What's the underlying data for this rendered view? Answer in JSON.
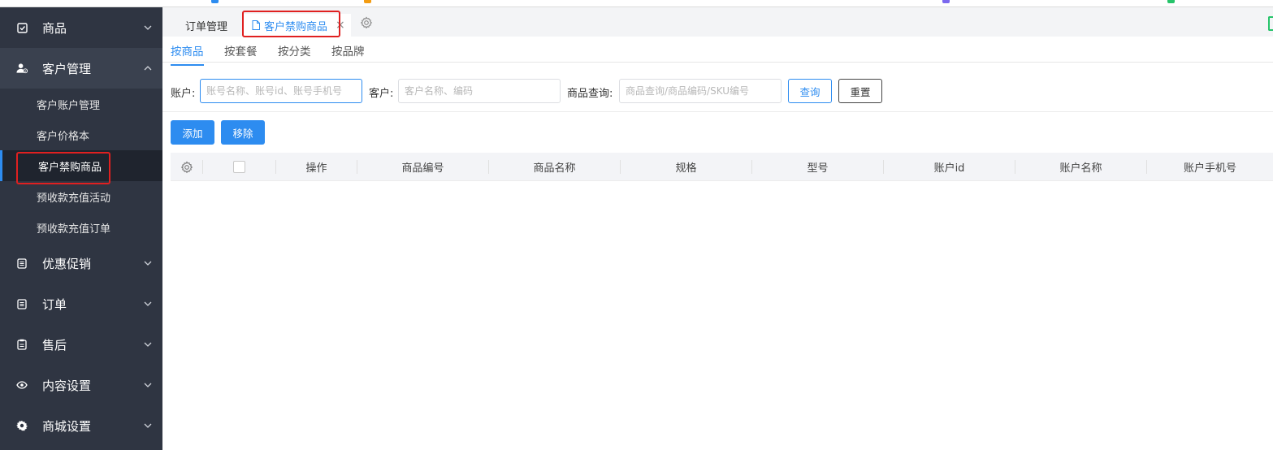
{
  "sidebar": {
    "groups": [
      {
        "label": "商品",
        "icon": "checkbox-icon"
      },
      {
        "label": "客户管理",
        "icon": "user-icon"
      },
      {
        "label": "优惠促销",
        "icon": "list-icon"
      },
      {
        "label": "订单",
        "icon": "list-icon"
      },
      {
        "label": "售后",
        "icon": "clipboard-icon"
      },
      {
        "label": "内容设置",
        "icon": "eye-icon"
      },
      {
        "label": "商城设置",
        "icon": "gear-icon"
      }
    ],
    "customer_sub": [
      {
        "label": "客户账户管理"
      },
      {
        "label": "客户价格本"
      },
      {
        "label": "客户禁购商品"
      },
      {
        "label": "预收款充值活动"
      },
      {
        "label": "预收款充值订单"
      }
    ]
  },
  "tabs": {
    "t1": "订单管理",
    "t2": "客户禁购商品",
    "close": "×"
  },
  "subtabs": [
    "按商品",
    "按套餐",
    "按分类",
    "按品牌"
  ],
  "filters": {
    "account_label": "账户:",
    "account_placeholder": "账号名称、账号id、账号手机号",
    "customer_label": "客户:",
    "customer_placeholder": "客户名称、编码",
    "product_label": "商品查询:",
    "product_placeholder": "商品查询/商品编码/SKU编号",
    "query": "查询",
    "reset": "重置"
  },
  "actions": {
    "add": "添加",
    "remove": "移除"
  },
  "table": {
    "columns": [
      "操作",
      "商品编号",
      "商品名称",
      "规格",
      "型号",
      "账户id",
      "账户名称",
      "账户手机号"
    ]
  },
  "colors": {
    "sidebar_bg": "#2f3542",
    "accent": "#2d8cf0",
    "highlight": "#e02020"
  }
}
